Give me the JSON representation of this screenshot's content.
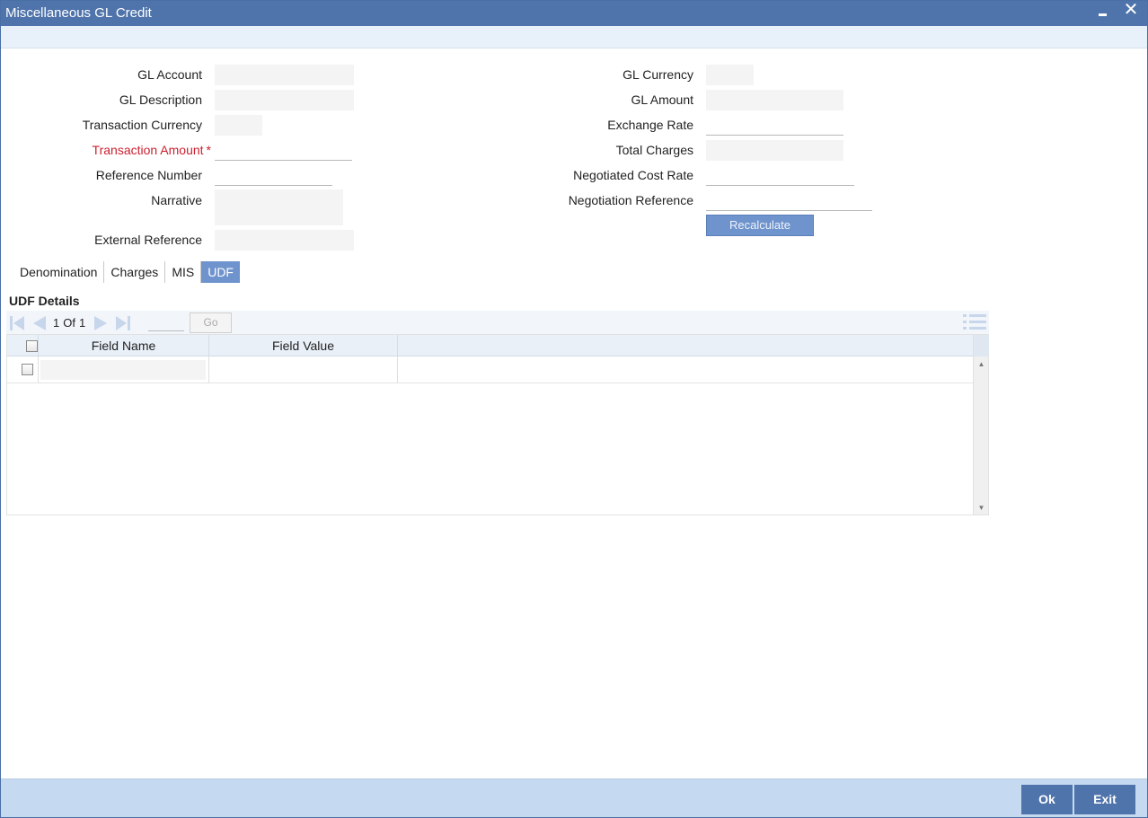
{
  "window": {
    "title": "Miscellaneous GL Credit",
    "close_glyph": "✕"
  },
  "form": {
    "left": [
      {
        "label": "GL Account",
        "value": ""
      },
      {
        "label": "GL Description",
        "value": ""
      },
      {
        "label": "Transaction Currency",
        "value": ""
      },
      {
        "label": "Transaction Amount",
        "value": "",
        "required": true,
        "required_marker": "*"
      },
      {
        "label": "Reference Number",
        "value": ""
      },
      {
        "label": "Narrative",
        "value": ""
      },
      {
        "label": "External Reference",
        "value": ""
      }
    ],
    "right": [
      {
        "label": "GL Currency",
        "value": ""
      },
      {
        "label": "GL Amount",
        "value": ""
      },
      {
        "label": "Exchange Rate",
        "value": ""
      },
      {
        "label": "Total Charges",
        "value": ""
      },
      {
        "label": "Negotiated Cost Rate",
        "value": ""
      },
      {
        "label": "Negotiation Reference",
        "value": ""
      }
    ],
    "recalculate_label": "Recalculate"
  },
  "tabs": [
    {
      "label": "Denomination",
      "active": false
    },
    {
      "label": "Charges",
      "active": false
    },
    {
      "label": "MIS",
      "active": false
    },
    {
      "label": "UDF",
      "active": true
    }
  ],
  "udf": {
    "section_title": "UDF Details",
    "pager": {
      "current": "1",
      "of_label": "Of",
      "total": "1",
      "go_label": "Go",
      "goto_value": ""
    },
    "columns": [
      "Field Name",
      "Field Value"
    ],
    "rows": [
      {
        "field_name": "",
        "field_value": ""
      }
    ]
  },
  "footer": {
    "ok_label": "Ok",
    "exit_label": "Exit"
  },
  "colors": {
    "title_bar": "#4f74ab",
    "accent": "#6f93cc",
    "required": "#cc1f2f",
    "footer_bar": "#c5daf0"
  },
  "icons": [
    "minimize-icon",
    "close-icon",
    "first-page-icon",
    "prev-page-icon",
    "next-page-icon",
    "last-page-icon",
    "list-view-icon",
    "scroll-up-icon",
    "scroll-down-icon"
  ]
}
